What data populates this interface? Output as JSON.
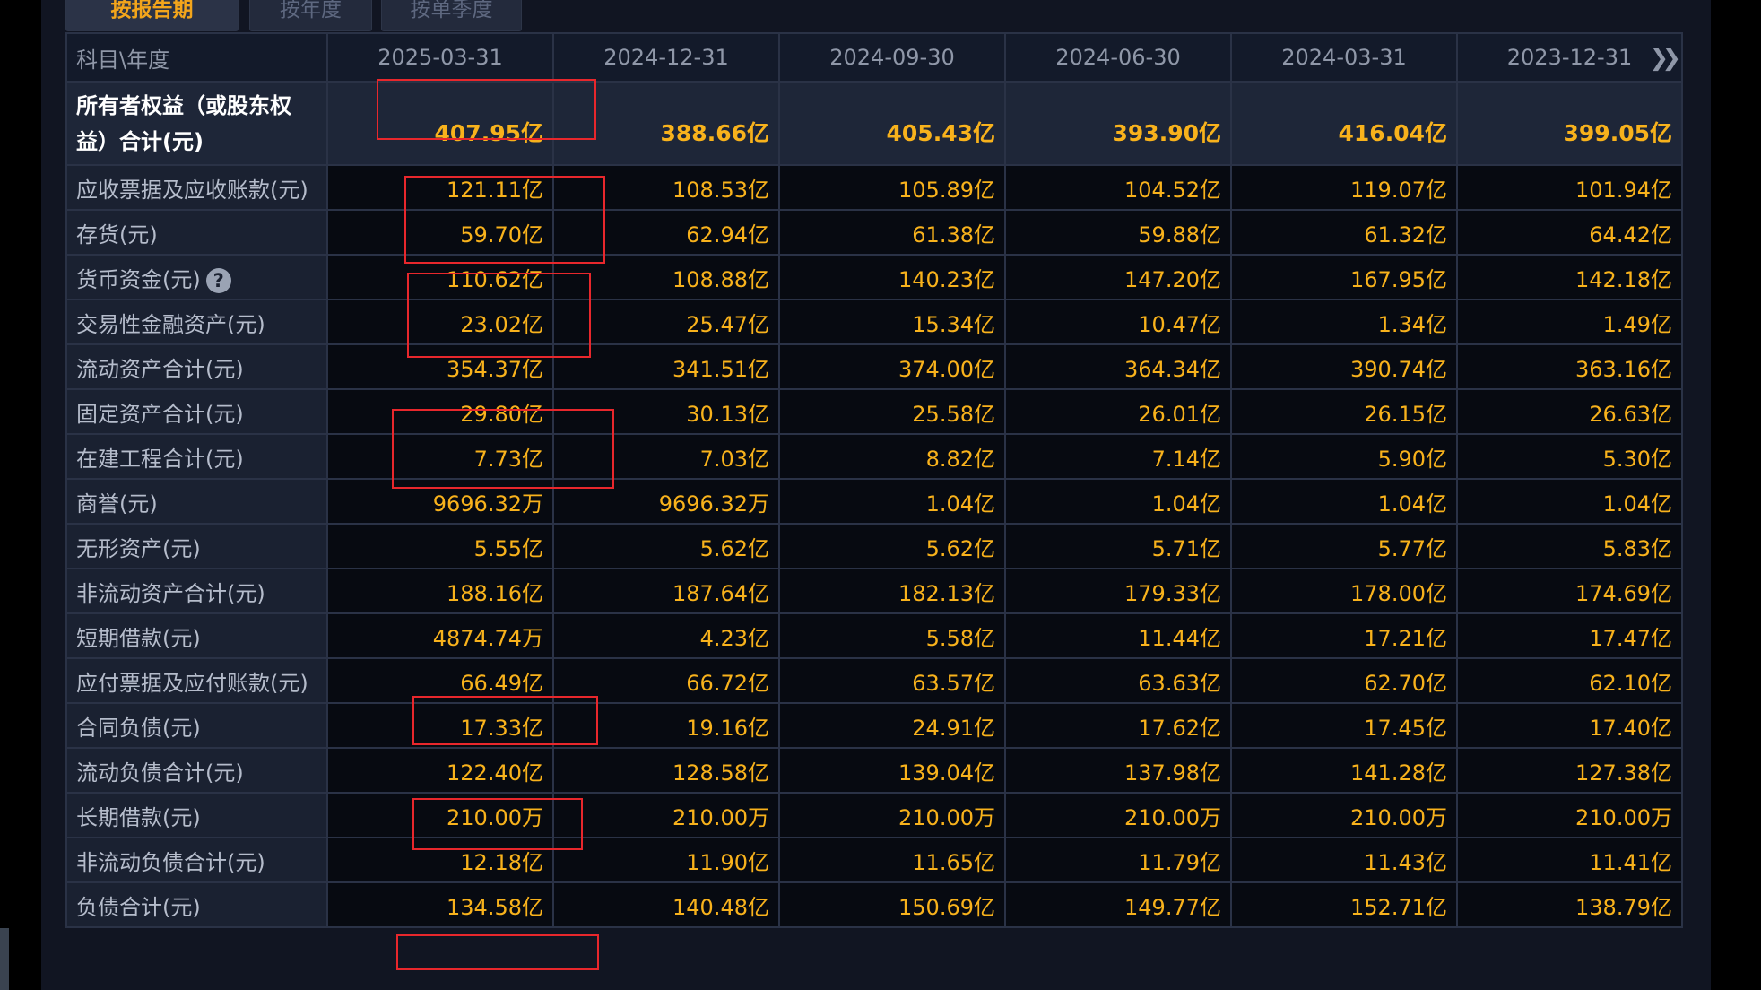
{
  "tabs": [
    {
      "label": "按报告期",
      "active": true
    },
    {
      "label": "按年度",
      "active": false
    },
    {
      "label": "按单季度",
      "active": false
    }
  ],
  "header": {
    "first_col": "科目\\年度",
    "periods": [
      "2025-03-31",
      "2024-12-31",
      "2024-09-30",
      "2024-06-30",
      "2024-03-31",
      "2023-12-31"
    ]
  },
  "rows": [
    {
      "label": "所有者权益（或股东权益）合计(元)",
      "values": [
        "407.95亿",
        "388.66亿",
        "405.43亿",
        "393.90亿",
        "416.04亿",
        "399.05亿"
      ]
    },
    {
      "label": "应收票据及应收账款(元)",
      "values": [
        "121.11亿",
        "108.53亿",
        "105.89亿",
        "104.52亿",
        "119.07亿",
        "101.94亿"
      ]
    },
    {
      "label": "存货(元)",
      "values": [
        "59.70亿",
        "62.94亿",
        "61.38亿",
        "59.88亿",
        "61.32亿",
        "64.42亿"
      ]
    },
    {
      "label": "货币资金(元)",
      "values": [
        "110.62亿",
        "108.88亿",
        "140.23亿",
        "147.20亿",
        "167.95亿",
        "142.18亿"
      ]
    },
    {
      "label": "交易性金融资产(元)",
      "values": [
        "23.02亿",
        "25.47亿",
        "15.34亿",
        "10.47亿",
        "1.34亿",
        "1.49亿"
      ]
    },
    {
      "label": "流动资产合计(元)",
      "values": [
        "354.37亿",
        "341.51亿",
        "374.00亿",
        "364.34亿",
        "390.74亿",
        "363.16亿"
      ]
    },
    {
      "label": "固定资产合计(元)",
      "values": [
        "29.80亿",
        "30.13亿",
        "25.58亿",
        "26.01亿",
        "26.15亿",
        "26.63亿"
      ]
    },
    {
      "label": "在建工程合计(元)",
      "values": [
        "7.73亿",
        "7.03亿",
        "8.82亿",
        "7.14亿",
        "5.90亿",
        "5.30亿"
      ]
    },
    {
      "label": "商誉(元)",
      "values": [
        "9696.32万",
        "9696.32万",
        "1.04亿",
        "1.04亿",
        "1.04亿",
        "1.04亿"
      ]
    },
    {
      "label": "无形资产(元)",
      "values": [
        "5.55亿",
        "5.62亿",
        "5.62亿",
        "5.71亿",
        "5.77亿",
        "5.83亿"
      ]
    },
    {
      "label": "非流动资产合计(元)",
      "values": [
        "188.16亿",
        "187.64亿",
        "182.13亿",
        "179.33亿",
        "178.00亿",
        "174.69亿"
      ]
    },
    {
      "label": "短期借款(元)",
      "values": [
        "4874.74万",
        "4.23亿",
        "5.58亿",
        "11.44亿",
        "17.21亿",
        "17.47亿"
      ]
    },
    {
      "label": "应付票据及应付账款(元)",
      "values": [
        "66.49亿",
        "66.72亿",
        "63.57亿",
        "63.63亿",
        "62.70亿",
        "62.10亿"
      ]
    },
    {
      "label": "合同负债(元)",
      "values": [
        "17.33亿",
        "19.16亿",
        "24.91亿",
        "17.62亿",
        "17.45亿",
        "17.40亿"
      ]
    },
    {
      "label": "流动负债合计(元)",
      "values": [
        "122.40亿",
        "128.58亿",
        "139.04亿",
        "137.98亿",
        "141.28亿",
        "127.38亿"
      ]
    },
    {
      "label": "长期借款(元)",
      "values": [
        "210.00万",
        "210.00万",
        "210.00万",
        "210.00万",
        "210.00万",
        "210.00万"
      ]
    },
    {
      "label": "非流动负债合计(元)",
      "values": [
        "12.18亿",
        "11.90亿",
        "11.65亿",
        "11.79亿",
        "11.43亿",
        "11.41亿"
      ]
    },
    {
      "label": "负债合计(元)",
      "values": [
        "134.58亿",
        "140.48亿",
        "150.69亿",
        "149.77亿",
        "152.71亿",
        "138.79亿"
      ]
    }
  ],
  "icons": {
    "help": "question-circle-icon",
    "more": "double-chevron-right-icon"
  },
  "colors": {
    "value": "#f8b21c",
    "active_tab": "#f3a51b",
    "annotation": "#e8272c"
  }
}
